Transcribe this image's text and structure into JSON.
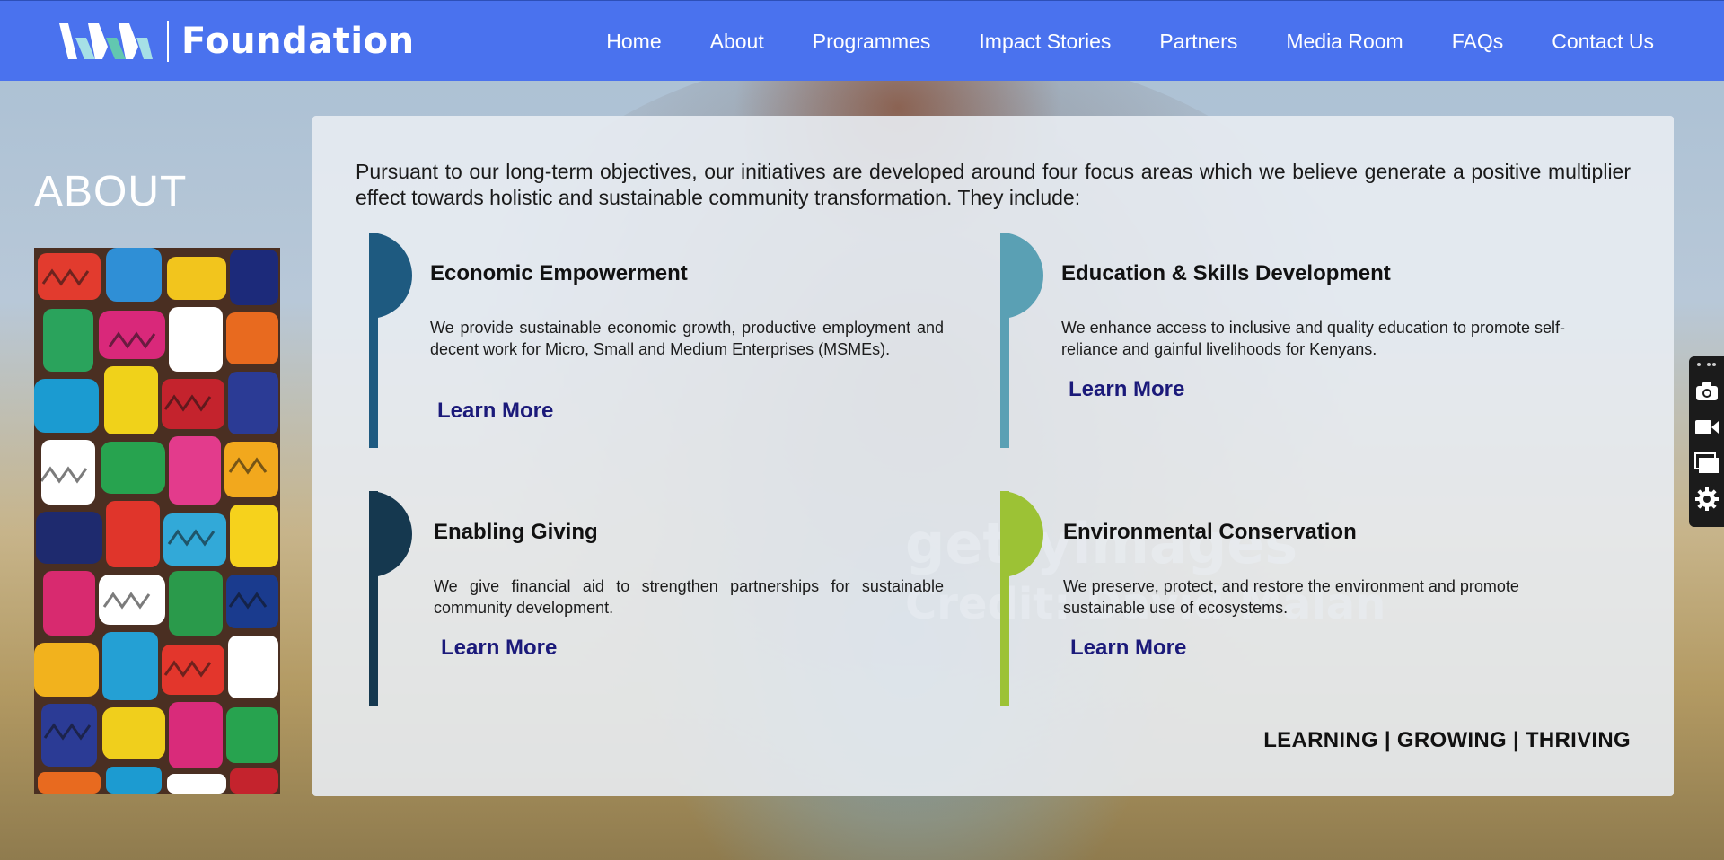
{
  "brand": {
    "logo_text": "Foundation"
  },
  "nav": {
    "items": [
      "Home",
      "About",
      "Programmes",
      "Impact Stories",
      "Partners",
      "Media Room",
      "FAQs",
      "Contact Us"
    ]
  },
  "page": {
    "title": "ABOUT"
  },
  "intro": "Pursuant to our long-term objectives, our initiatives are developed around four focus areas which we believe generate a positive multiplier effect towards holistic and sustainable community transformation. They include:",
  "focus_areas": [
    {
      "title": "Economic Empowerment",
      "body": "We provide sustainable economic growth, productive employment and decent work for Micro, Small and Medium Enterprises (MSMEs).",
      "cta": "Learn More",
      "color": "#1e5a80"
    },
    {
      "title": "Education & Skills Development",
      "body": "We enhance access to inclusive and quality education to promote self-reliance and gainful livelihoods for Kenyans.",
      "cta": "Learn More",
      "color": "#5aa0b4"
    },
    {
      "title": "Enabling Giving",
      "body": "We give financial aid to strengthen partnerships for sustainable community development.",
      "cta": "Learn More",
      "color": "#15384f"
    },
    {
      "title": "Environmental Conservation",
      "body": "We preserve, protect, and restore the environment and promote sustainable use of ecosystems.",
      "cta": "Learn More",
      "color": "#9cc235"
    }
  ],
  "tagline": "LEARNING | GROWING | THRIVING",
  "watermark": {
    "line1": "gettyimages",
    "line2": "Credit: David Malan"
  },
  "toolbar": {
    "icons": [
      "camera-icon",
      "video-icon",
      "window-icon",
      "gear-icon"
    ]
  },
  "colors": {
    "header_bg": "#4a72ee",
    "link": "#1b1a7a"
  }
}
